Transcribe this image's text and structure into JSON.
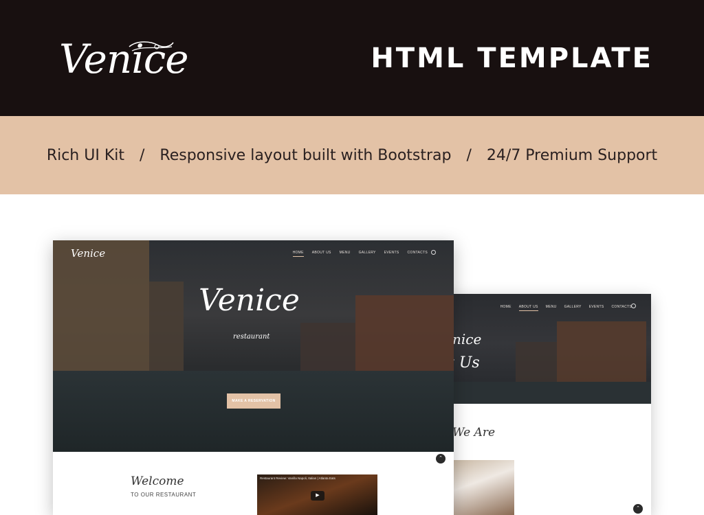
{
  "banner": {
    "logo_text": "Venice",
    "title": "HTML TEMPLATE"
  },
  "features": {
    "items": [
      "Rich UI Kit",
      "Responsive layout built with Bootstrap",
      "24/7 Premium Support"
    ],
    "separator": "/"
  },
  "front_mock": {
    "logo": "Venice",
    "nav": [
      "HOME",
      "ABOUT US",
      "MENU",
      "GALLERY",
      "EVENTS",
      "CONTACTS"
    ],
    "hero_title": "Venice",
    "hero_subtitle": "restaurant",
    "cta_label": "MAKE A RESERVATION",
    "welcome_title": "Welcome",
    "welcome_sub": "TO OUR RESTAURANT",
    "video_title": "Restaurant Review: Vanilla Napoli, Italian | Atlanta Eats",
    "play_icon": "▶",
    "scroll_icon": "⌃"
  },
  "back_mock": {
    "nav": [
      "HOME",
      "ABOUT US",
      "MENU",
      "GALLERY",
      "EVENTS",
      "CONTACTS"
    ],
    "hero_title_fragment": "nice",
    "hero_title2_fragment": "t Us",
    "who_title_fragment": "We Are",
    "scroll_icon": "⌃"
  },
  "colors": {
    "banner_bg": "#181010",
    "strip_bg": "#e3c2a6",
    "accent": "#e3c2a6"
  }
}
